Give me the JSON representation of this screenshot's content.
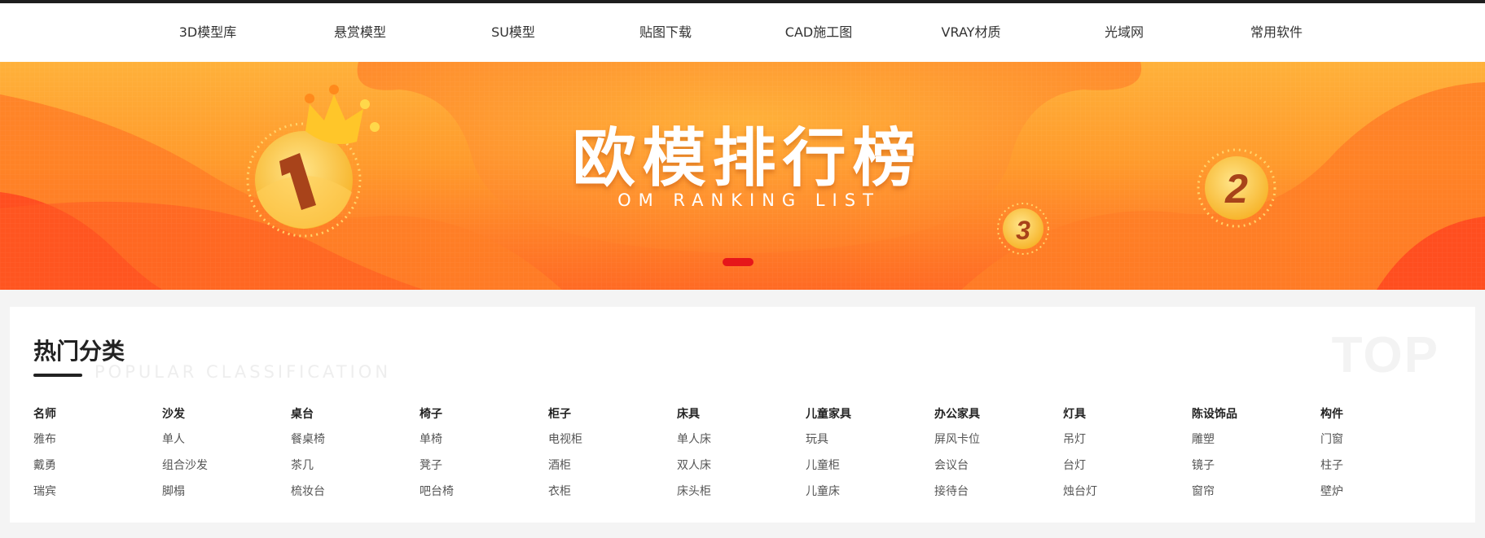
{
  "nav": {
    "items": [
      "3D模型库",
      "悬赏模型",
      "SU模型",
      "贴图下载",
      "CAD施工图",
      "VRAY材质",
      "光域网",
      "常用软件"
    ]
  },
  "banner": {
    "title": "欧模排行榜",
    "subtitle": "OM RANKING LIST",
    "medals": [
      "1",
      "2",
      "3"
    ],
    "colors": {
      "top": "#ffb13a",
      "bottom": "#ff6a24",
      "active_dot": "#e6161a"
    }
  },
  "section": {
    "title": "热门分类",
    "subtitle": "POPULAR CLASSIFICATION",
    "watermark": "TOP"
  },
  "categories": [
    {
      "name": "名师",
      "items": [
        "雅布",
        "戴勇",
        "瑞宾"
      ]
    },
    {
      "name": "沙发",
      "items": [
        "单人",
        "组合沙发",
        "脚榻"
      ]
    },
    {
      "name": "桌台",
      "items": [
        "餐桌椅",
        "茶几",
        "梳妆台"
      ]
    },
    {
      "name": "椅子",
      "items": [
        "单椅",
        "凳子",
        "吧台椅"
      ]
    },
    {
      "name": "柜子",
      "items": [
        "电视柜",
        "酒柜",
        "衣柜"
      ]
    },
    {
      "name": "床具",
      "items": [
        "单人床",
        "双人床",
        "床头柜"
      ]
    },
    {
      "name": "儿童家具",
      "items": [
        "玩具",
        "儿童柜",
        "儿童床"
      ]
    },
    {
      "name": "办公家具",
      "items": [
        "屏风卡位",
        "会议台",
        "接待台"
      ]
    },
    {
      "name": "灯具",
      "items": [
        "吊灯",
        "台灯",
        "烛台灯"
      ]
    },
    {
      "name": "陈设饰品",
      "items": [
        "雕塑",
        "镜子",
        "窗帘"
      ]
    },
    {
      "name": "构件",
      "items": [
        "门窗",
        "柱子",
        "壁炉"
      ]
    }
  ]
}
